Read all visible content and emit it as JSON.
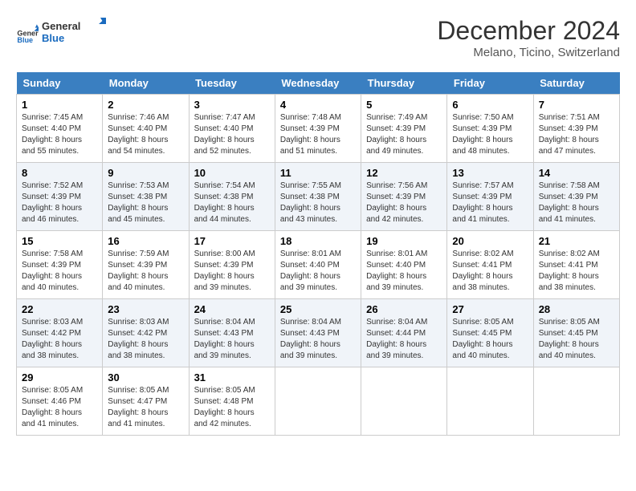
{
  "logo": {
    "general": "General",
    "blue": "Blue"
  },
  "title": "December 2024",
  "subtitle": "Melano, Ticino, Switzerland",
  "days_header": [
    "Sunday",
    "Monday",
    "Tuesday",
    "Wednesday",
    "Thursday",
    "Friday",
    "Saturday"
  ],
  "weeks": [
    [
      {
        "day": "1",
        "sunrise": "7:45 AM",
        "sunset": "4:40 PM",
        "daylight": "8 hours and 55 minutes."
      },
      {
        "day": "2",
        "sunrise": "7:46 AM",
        "sunset": "4:40 PM",
        "daylight": "8 hours and 54 minutes."
      },
      {
        "day": "3",
        "sunrise": "7:47 AM",
        "sunset": "4:40 PM",
        "daylight": "8 hours and 52 minutes."
      },
      {
        "day": "4",
        "sunrise": "7:48 AM",
        "sunset": "4:39 PM",
        "daylight": "8 hours and 51 minutes."
      },
      {
        "day": "5",
        "sunrise": "7:49 AM",
        "sunset": "4:39 PM",
        "daylight": "8 hours and 49 minutes."
      },
      {
        "day": "6",
        "sunrise": "7:50 AM",
        "sunset": "4:39 PM",
        "daylight": "8 hours and 48 minutes."
      },
      {
        "day": "7",
        "sunrise": "7:51 AM",
        "sunset": "4:39 PM",
        "daylight": "8 hours and 47 minutes."
      }
    ],
    [
      {
        "day": "8",
        "sunrise": "7:52 AM",
        "sunset": "4:39 PM",
        "daylight": "8 hours and 46 minutes."
      },
      {
        "day": "9",
        "sunrise": "7:53 AM",
        "sunset": "4:38 PM",
        "daylight": "8 hours and 45 minutes."
      },
      {
        "day": "10",
        "sunrise": "7:54 AM",
        "sunset": "4:38 PM",
        "daylight": "8 hours and 44 minutes."
      },
      {
        "day": "11",
        "sunrise": "7:55 AM",
        "sunset": "4:38 PM",
        "daylight": "8 hours and 43 minutes."
      },
      {
        "day": "12",
        "sunrise": "7:56 AM",
        "sunset": "4:39 PM",
        "daylight": "8 hours and 42 minutes."
      },
      {
        "day": "13",
        "sunrise": "7:57 AM",
        "sunset": "4:39 PM",
        "daylight": "8 hours and 41 minutes."
      },
      {
        "day": "14",
        "sunrise": "7:58 AM",
        "sunset": "4:39 PM",
        "daylight": "8 hours and 41 minutes."
      }
    ],
    [
      {
        "day": "15",
        "sunrise": "7:58 AM",
        "sunset": "4:39 PM",
        "daylight": "8 hours and 40 minutes."
      },
      {
        "day": "16",
        "sunrise": "7:59 AM",
        "sunset": "4:39 PM",
        "daylight": "8 hours and 40 minutes."
      },
      {
        "day": "17",
        "sunrise": "8:00 AM",
        "sunset": "4:39 PM",
        "daylight": "8 hours and 39 minutes."
      },
      {
        "day": "18",
        "sunrise": "8:01 AM",
        "sunset": "4:40 PM",
        "daylight": "8 hours and 39 minutes."
      },
      {
        "day": "19",
        "sunrise": "8:01 AM",
        "sunset": "4:40 PM",
        "daylight": "8 hours and 39 minutes."
      },
      {
        "day": "20",
        "sunrise": "8:02 AM",
        "sunset": "4:41 PM",
        "daylight": "8 hours and 38 minutes."
      },
      {
        "day": "21",
        "sunrise": "8:02 AM",
        "sunset": "4:41 PM",
        "daylight": "8 hours and 38 minutes."
      }
    ],
    [
      {
        "day": "22",
        "sunrise": "8:03 AM",
        "sunset": "4:42 PM",
        "daylight": "8 hours and 38 minutes."
      },
      {
        "day": "23",
        "sunrise": "8:03 AM",
        "sunset": "4:42 PM",
        "daylight": "8 hours and 38 minutes."
      },
      {
        "day": "24",
        "sunrise": "8:04 AM",
        "sunset": "4:43 PM",
        "daylight": "8 hours and 39 minutes."
      },
      {
        "day": "25",
        "sunrise": "8:04 AM",
        "sunset": "4:43 PM",
        "daylight": "8 hours and 39 minutes."
      },
      {
        "day": "26",
        "sunrise": "8:04 AM",
        "sunset": "4:44 PM",
        "daylight": "8 hours and 39 minutes."
      },
      {
        "day": "27",
        "sunrise": "8:05 AM",
        "sunset": "4:45 PM",
        "daylight": "8 hours and 40 minutes."
      },
      {
        "day": "28",
        "sunrise": "8:05 AM",
        "sunset": "4:45 PM",
        "daylight": "8 hours and 40 minutes."
      }
    ],
    [
      {
        "day": "29",
        "sunrise": "8:05 AM",
        "sunset": "4:46 PM",
        "daylight": "8 hours and 41 minutes."
      },
      {
        "day": "30",
        "sunrise": "8:05 AM",
        "sunset": "4:47 PM",
        "daylight": "8 hours and 41 minutes."
      },
      {
        "day": "31",
        "sunrise": "8:05 AM",
        "sunset": "4:48 PM",
        "daylight": "8 hours and 42 minutes."
      },
      null,
      null,
      null,
      null
    ]
  ],
  "labels": {
    "sunrise": "Sunrise:",
    "sunset": "Sunset:",
    "daylight": "Daylight:"
  }
}
